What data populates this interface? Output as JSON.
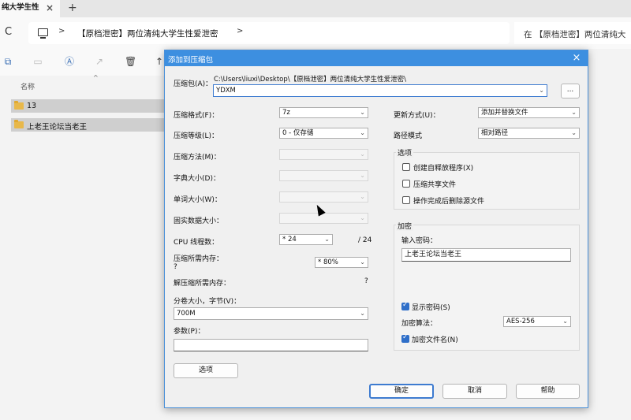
{
  "explorer": {
    "tab_title": "纯大学生性",
    "tab_close": "×",
    "tab_new": "+",
    "refresh": "C",
    "breadcrumb_sep": ">",
    "address": "【原档泄密】两位清纯大学生性爱泄密",
    "address_chevron": ">",
    "search_text": "在 【原档泄密】两位清纯大",
    "column_name": "名称",
    "sort_caret": "^",
    "files": [
      "13",
      "上老王论坛当老王"
    ]
  },
  "dialog": {
    "title": "添加到压缩包",
    "close": "×",
    "archive_label": "压缩包(A)：",
    "archive_path": "C:\\Users\\liuxi\\Desktop\\【原档泄密】两位清纯大学生性爱泄密\\",
    "archive_name": "YDXM",
    "browse": "...",
    "left": {
      "format_label": "压缩格式(F)：",
      "format_value": "7z",
      "level_label": "压缩等级(L)：",
      "level_value": "0 - 仅存储",
      "method_label": "压缩方法(M)：",
      "dict_label": "字典大小(D)：",
      "word_label": "单词大小(W)：",
      "solid_label": "固实数据大小：",
      "threads_label": "CPU 线程数：",
      "threads_value": "* 24",
      "threads_total": "/ 24",
      "mem_label": "压缩所需内存：",
      "mem_q": "?",
      "mem_value": "* 80%",
      "decomp_label": "解压缩所需内存：",
      "decomp_q": "?",
      "split_label": "分卷大小，字节(V)：",
      "split_value": "700M",
      "params_label": "参数(P)：",
      "params_value": "",
      "options_button": "选项"
    },
    "right": {
      "update_label": "更新方式(U)：",
      "update_value": "添加并替换文件",
      "path_label": "路径模式",
      "path_value": "相对路径",
      "options_group": "选项",
      "opt_sfx": "创建自释放程序(X)",
      "opt_shared": "压缩共享文件",
      "opt_delete": "操作完成后删除源文件",
      "enc_group": "加密",
      "pwd_label": "输入密码：",
      "pwd_value": "上老王论坛当老王",
      "show_pwd": "显示密码(S)",
      "enc_method_label": "加密算法：",
      "enc_method_value": "AES-256",
      "enc_names": "加密文件名(N)"
    },
    "buttons": {
      "ok": "确定",
      "cancel": "取消",
      "help": "帮助"
    }
  },
  "dropdown_glyph": "⌄",
  "colors": {
    "title_bar": "#3d8fe0",
    "checkbox_on": "#2f6fc9"
  }
}
